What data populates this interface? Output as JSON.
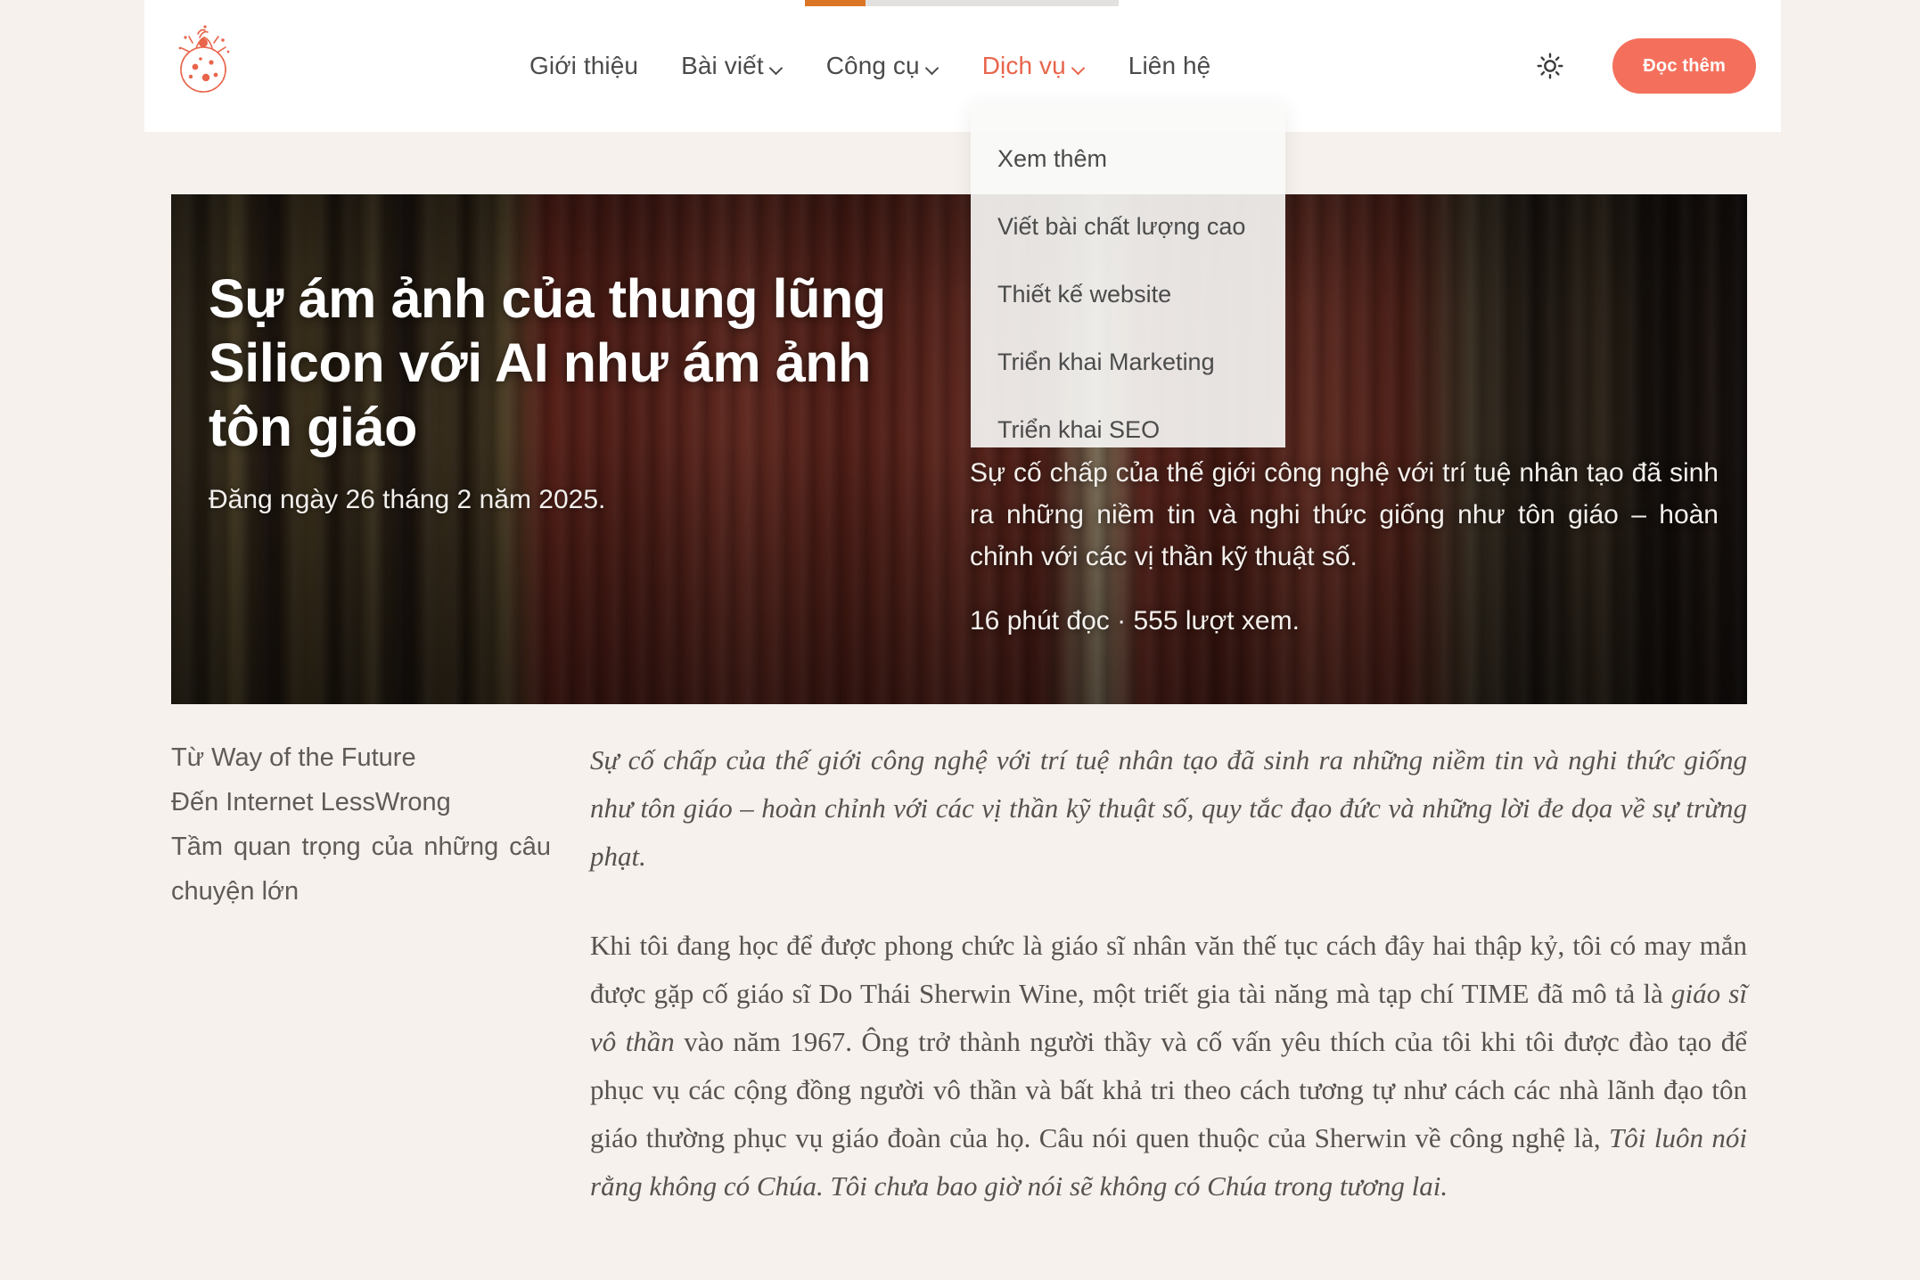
{
  "brand": {
    "logo_icon": "little-prince-planet-logo",
    "accent": "#F4705C"
  },
  "progress": {
    "percent": 19
  },
  "nav": {
    "items": [
      {
        "label": "Giới thiệu",
        "has_caret": false,
        "active": false
      },
      {
        "label": "Bài viết",
        "has_caret": true,
        "active": false
      },
      {
        "label": "Công cụ",
        "has_caret": true,
        "active": false
      },
      {
        "label": "Dịch vụ",
        "has_caret": true,
        "active": true
      },
      {
        "label": "Liên hệ",
        "has_caret": false,
        "active": false
      }
    ]
  },
  "header_right": {
    "theme_icon": "sun-icon",
    "cta_label": "Đọc thêm"
  },
  "dropdown": {
    "open_for": "Dịch vụ",
    "items": [
      "Xem thêm",
      "Viết bài chất lượng cao",
      "Thiết kế website",
      "Triển khai Marketing",
      "Triển khai SEO"
    ]
  },
  "hero": {
    "title": "Sự ám ảnh của thung lũng Silicon với AI như ám ảnh tôn giáo",
    "date": "Đăng ngày 26 tháng 2 năm 2025.",
    "excerpt": "Sự cố chấp của thế giới công nghệ với trí tuệ nhân tạo đã sinh ra những niềm tin và nghi thức giống như tôn giáo – hoàn chỉnh với các vị thần kỹ thuật số.",
    "meta": "16 phút đọc · 555 lượt xem."
  },
  "toc": {
    "items": [
      "Từ Way of the Future",
      "Đến Internet LessWrong",
      "Tầm quan trọng của những câu chuyện lớn"
    ]
  },
  "article": {
    "lead": "Sự cố chấp của thế giới công nghệ với trí tuệ nhân tạo đã sinh ra những niềm tin và nghi thức giống như tôn giáo – hoàn chỉnh với các vị thần kỹ thuật số, quy tắc đạo đức và những lời đe dọa về sự trừng phạt.",
    "paragraph_1_a": "Khi tôi đang học để được phong chức là giáo sĩ nhân văn thế tục cách đây hai thập kỷ, tôi có may mắn được gặp cố giáo sĩ Do Thái Sherwin Wine, một triết gia tài năng mà tạp chí TIME đã mô tả là ",
    "paragraph_1_em1": "giáo sĩ vô thần",
    "paragraph_1_b": " vào năm 1967. Ông trở thành người thầy và cố vấn yêu thích của tôi khi tôi được đào tạo để phục vụ các cộng đồng người vô thần và bất khả tri theo cách tương tự như cách các nhà lãnh đạo tôn giáo thường phục vụ giáo đoàn của họ. Câu nói quen thuộc của Sherwin về công nghệ là, ",
    "paragraph_1_em2": "Tôi luôn nói rằng không có Chúa. Tôi chưa bao giờ nói sẽ không có Chúa trong tương lai."
  }
}
